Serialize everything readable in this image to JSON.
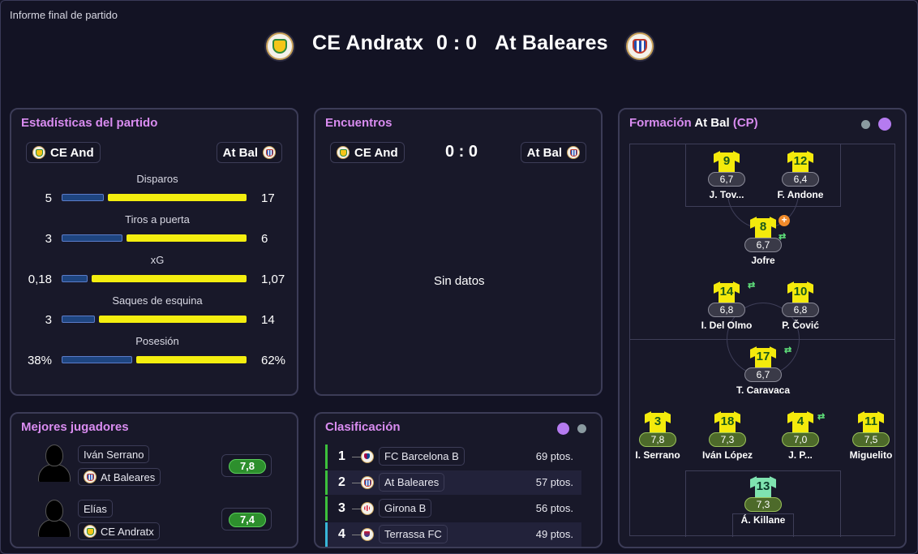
{
  "window": {
    "title": "Informe final de partido"
  },
  "match": {
    "home": "CE Andratx",
    "away": "At Baleares",
    "score": "0 : 0"
  },
  "stats_panel": {
    "title": "Estadísticas del partido",
    "home_short": "CE And",
    "away_short": "At Bal",
    "stats": [
      {
        "label": "Disparos",
        "home": "5",
        "away": "17",
        "home_share": 0.23
      },
      {
        "label": "Tiros a puerta",
        "home": "3",
        "away": "6",
        "home_share": 0.33
      },
      {
        "label": "xG",
        "home": "0,18",
        "away": "1,07",
        "home_share": 0.14
      },
      {
        "label": "Saques de esquina",
        "home": "3",
        "away": "14",
        "home_share": 0.18
      },
      {
        "label": "Posesión",
        "home": "38%",
        "away": "62%",
        "home_share": 0.38
      }
    ]
  },
  "encounters_panel": {
    "title": "Encuentros",
    "home_short": "CE And",
    "away_short": "At Bal",
    "score": "0 : 0",
    "empty_text": "Sin datos"
  },
  "best_players": {
    "title": "Mejores jugadores",
    "players": [
      {
        "name": "Iván Serrano",
        "team": "At Baleares",
        "rating": "7,8"
      },
      {
        "name": "Elías",
        "team": "CE Andratx",
        "rating": "7,4"
      }
    ]
  },
  "standings": {
    "title": "Clasificación",
    "rows": [
      {
        "pos": "1",
        "dash": "—",
        "team": "FC Barcelona B",
        "pts": "69 ptos.",
        "accent": "#3cc03c"
      },
      {
        "pos": "2",
        "dash": "—",
        "team": "At Baleares",
        "pts": "57 ptos.",
        "accent": "#3cc03c"
      },
      {
        "pos": "3",
        "dash": "—",
        "team": "Girona B",
        "pts": "56 ptos.",
        "accent": "#3cc03c"
      },
      {
        "pos": "4",
        "dash": "—",
        "team": "Terrassa FC",
        "pts": "49 ptos.",
        "accent": "#38b6d8"
      }
    ]
  },
  "formation": {
    "title_prefix": "Formación",
    "team": "At Bal",
    "tag": "(CP)",
    "players": [
      {
        "num": "9",
        "rating": "6,7",
        "name": "J. Tov..."
      },
      {
        "num": "12",
        "rating": "6,4",
        "name": "F. Andone"
      },
      {
        "num": "8",
        "rating": "6,7",
        "name": "Jofre"
      },
      {
        "num": "14",
        "rating": "6,8",
        "name": "I. Del Olmo"
      },
      {
        "num": "10",
        "rating": "6,8",
        "name": "P. Čović"
      },
      {
        "num": "17",
        "rating": "6,7",
        "name": "T. Caravaca"
      },
      {
        "num": "3",
        "rating": "7,8",
        "name": "I. Serrano"
      },
      {
        "num": "18",
        "rating": "7,3",
        "name": "Iván López"
      },
      {
        "num": "4",
        "rating": "7,0",
        "name": "J. P..."
      },
      {
        "num": "11",
        "rating": "7,5",
        "name": "Miguelito"
      },
      {
        "num": "13",
        "rating": "7,3",
        "name": "Á. Killane"
      }
    ]
  },
  "colors": {
    "accent_pink": "#d98cf0",
    "bar_home": "#1e4580",
    "bar_away": "#f4ee0f",
    "dot_purple": "#b57bf0",
    "dot_grey": "#8a9aa0"
  },
  "icons": {
    "swap": "swap-arrows-icon",
    "plus": "plus-badge-icon"
  }
}
